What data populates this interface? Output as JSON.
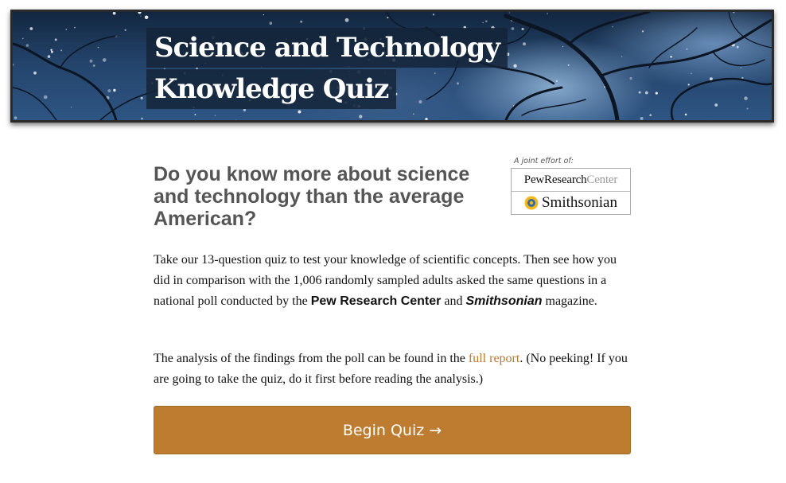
{
  "banner": {
    "title_line1": "Science and Technology",
    "title_line2": "Knowledge Quiz"
  },
  "headline": "Do you know more about science and technology than the average American?",
  "partners": {
    "caption": "A joint effort of:",
    "pew_main": "PewResearch",
    "pew_suffix": "Center",
    "smithsonian": "Smithsonian"
  },
  "intro": {
    "part1": "Take our 13-question quiz to test your knowledge of scientific concepts. Then see how you did in comparison with the 1,006 randomly sampled adults asked the same questions in a national poll conducted by the ",
    "pew_name": "Pew Research Center",
    "part2": " and ",
    "smithsonian_name": "Smithsonian",
    "part3": " magazine."
  },
  "analysis": {
    "part1": "The analysis of the findings from the poll can be found in the ",
    "link_text": "full report",
    "part2": ". (No peeking! If you are going to take the quiz, do it first before reading the analysis.)"
  },
  "begin_button": "Begin Quiz →",
  "colors": {
    "accent": "#bd7c2f",
    "link": "#b57a2d",
    "headline": "#555555"
  }
}
